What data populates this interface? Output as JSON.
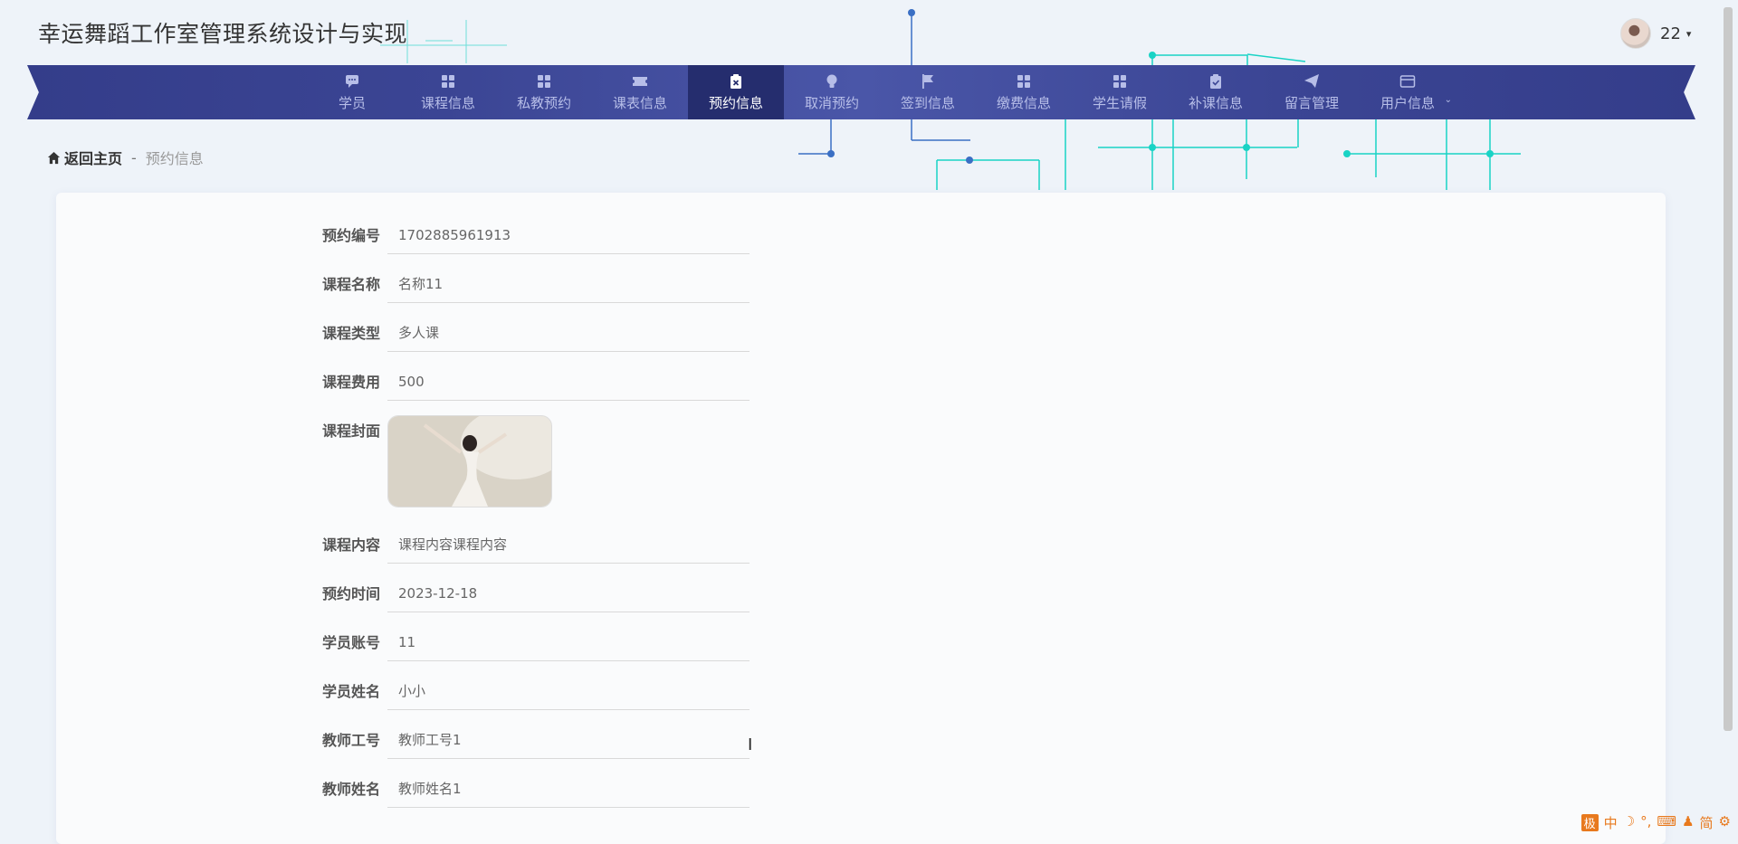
{
  "header": {
    "app_title": "幸运舞蹈工作室管理系统设计与实现",
    "user_name": "22",
    "dropdown_caret": "▾"
  },
  "nav": {
    "items": [
      {
        "label": "学员",
        "icon": "chat-icon",
        "active": false
      },
      {
        "label": "课程信息",
        "icon": "grid-icon",
        "active": false
      },
      {
        "label": "私教预约",
        "icon": "grid-icon",
        "active": false
      },
      {
        "label": "课表信息",
        "icon": "ticket-icon",
        "active": false
      },
      {
        "label": "预约信息",
        "icon": "clipboard-x-icon",
        "active": true
      },
      {
        "label": "取消预约",
        "icon": "bulb-icon",
        "active": false
      },
      {
        "label": "签到信息",
        "icon": "flag-icon",
        "active": false
      },
      {
        "label": "缴费信息",
        "icon": "grid-icon",
        "active": false
      },
      {
        "label": "学生请假",
        "icon": "grid-icon",
        "active": false
      },
      {
        "label": "补课信息",
        "icon": "clipboard-check-icon",
        "active": false
      },
      {
        "label": "留言管理",
        "icon": "send-icon",
        "active": false
      },
      {
        "label": "用户信息",
        "icon": "card-icon",
        "active": false,
        "dropdown": "⌄"
      }
    ]
  },
  "breadcrumb": {
    "home": "返回主页",
    "separator": "-",
    "current": "预约信息"
  },
  "form": {
    "rows": [
      {
        "label": "预约编号",
        "value": "1702885961913"
      },
      {
        "label": "课程名称",
        "value": "名称11"
      },
      {
        "label": "课程类型",
        "value": "多人课"
      },
      {
        "label": "课程费用",
        "value": "500"
      },
      {
        "label": "课程封面",
        "value": ""
      },
      {
        "label": "课程内容",
        "value": "课程内容课程内容"
      },
      {
        "label": "预约时间",
        "value": "2023-12-18"
      },
      {
        "label": "学员账号",
        "value": "11"
      },
      {
        "label": "学员姓名",
        "value": "小小"
      },
      {
        "label": "教师工号",
        "value": "教师工号1"
      },
      {
        "label": "教师姓名",
        "value": "教师姓名1"
      }
    ]
  },
  "ime": {
    "logo": "极",
    "items": [
      "中",
      "☽",
      "°,",
      "⌨",
      "♟",
      "简",
      "⚙"
    ]
  },
  "colors": {
    "nav_bg": "#3b4594",
    "nav_active": "#252d6e",
    "deco_cyan": "#19d3c5",
    "deco_blue": "#3a6fc4"
  }
}
